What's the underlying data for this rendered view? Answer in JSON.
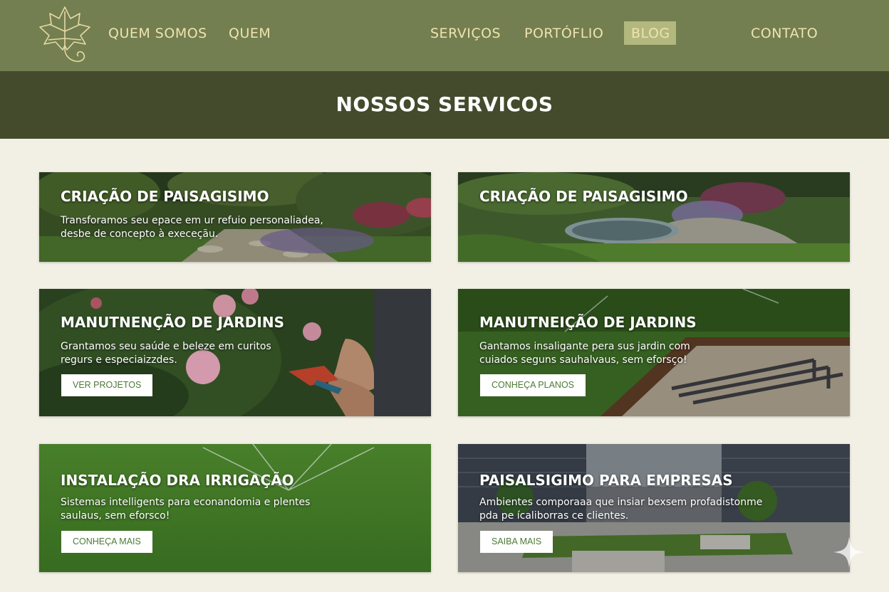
{
  "header": {
    "nav": [
      {
        "label": "QUEM SOMOS"
      },
      {
        "label": "QUEM"
      },
      {
        "label": "SERVIÇOS"
      },
      {
        "label": "PORTÓFLIO"
      },
      {
        "label": "BLOG",
        "active": true
      },
      {
        "label": "CONTATO"
      }
    ]
  },
  "banner": {
    "title": "NOSSOS SERVICOS"
  },
  "cards": [
    {
      "title": "CRIAÇÃO DE PAISAGISIMO",
      "description": "Transforamos seu epace em ur refuio personaliadea, desbe de concepto à execeçãu."
    },
    {
      "title": "CRIAÇÃO DE PAISAGISIMO"
    },
    {
      "title": "MANUTNENÇÃO DE JARDINS",
      "description": "Grantamos seu saúde e beleze em curitos regurs e especiaizzdes.",
      "button": "VER PROJETOS"
    },
    {
      "title": "MANUTNEIÇÃO DE JARDINS",
      "description": "Gantamos insaligante pera sus jardin com cuiados seguns sauhalvaus, sem eforsço!",
      "button": "CONHEÇA PLANOS"
    },
    {
      "title": "INSTALAÇÃO DRA IRRIGAÇÃO",
      "description": "Sistemas intelligents para econandomia e plentes saulaus, sem eforsco!",
      "button": "CONHEÇA MAIS"
    },
    {
      "title": "PAISALSIGIMO PARA EMPRESAS",
      "description": "Ambientes comporaaa que insiar bexsem profadistonme pda pe ícaliborras ce clientes.",
      "button": "SAIBA MAIS"
    }
  ],
  "colors": {
    "header_bg": "#737f50",
    "banner_bg": "#434b2c",
    "nav_text": "#efe3b0",
    "nav_active_bg": "#b3b87f",
    "page_bg": "#f2f0e4",
    "button_text": "#4c7a36"
  },
  "icons": {
    "logo": "ivy-leaf-logo",
    "corner": "sparkle-icon"
  }
}
